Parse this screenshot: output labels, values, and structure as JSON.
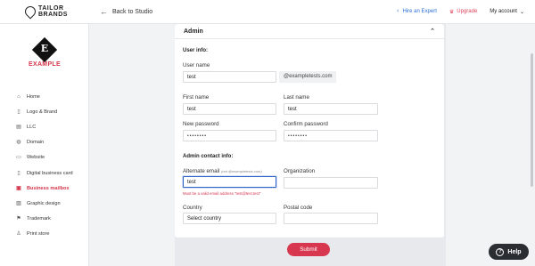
{
  "topbar": {
    "brand_line1": "TAILOR",
    "brand_line2": "BRANDS",
    "back_label": "Back to Studio",
    "hire_label": "Hire an Expert",
    "upgrade_label": "Upgrade",
    "account_label": "My account"
  },
  "sidebar": {
    "logo_letter": "E",
    "logo_name": "EXAMPLE",
    "items": [
      {
        "label": "Home",
        "icon": "home-icon",
        "glyph": "⌂"
      },
      {
        "label": "Logo & Brand",
        "icon": "document-icon",
        "glyph": "▯"
      },
      {
        "label": "LLC",
        "icon": "building-icon",
        "glyph": "▤"
      },
      {
        "label": "Domain",
        "icon": "globe-icon",
        "glyph": "◍"
      },
      {
        "label": "Website",
        "icon": "website-icon",
        "glyph": "▭"
      },
      {
        "label": "Digital business card",
        "icon": "card-icon",
        "glyph": "▯"
      },
      {
        "label": "Business mailbox",
        "icon": "mailbox-icon",
        "glyph": "▣"
      },
      {
        "label": "Graphic design",
        "icon": "image-icon",
        "glyph": "▨"
      },
      {
        "label": "Trademark",
        "icon": "trademark-icon",
        "glyph": "⚑"
      },
      {
        "label": "Print store",
        "icon": "shirt-icon",
        "glyph": "♙"
      }
    ],
    "active_index": 6
  },
  "panel": {
    "title": "Admin",
    "user_info_title": "User info:",
    "username_label": "User name",
    "username_value": "test",
    "domain_suffix": "@exampletests.com",
    "firstname_label": "First name",
    "firstname_value": "test",
    "lastname_label": "Last name",
    "lastname_value": "test",
    "password_label": "New password",
    "password_value": "••••••••",
    "confirm_label": "Confirm password",
    "confirm_value": "••••••••",
    "contact_title": "Admin contact info:",
    "alt_email_label": "Alternate email",
    "alt_email_hint": "(not @exampletests.com)",
    "alt_email_value": "test",
    "alt_email_error": "Must be a valid email address \"test@test.test\"",
    "org_label": "Organization",
    "org_value": "",
    "country_label": "Country",
    "country_value": "Select country",
    "postal_label": "Postal code",
    "postal_value": ""
  },
  "submit_label": "Submit",
  "help_label": "Help",
  "colors": {
    "accent": "#d8384f",
    "link_blue": "#2b6fd6",
    "focus_blue": "#2f63c8"
  }
}
